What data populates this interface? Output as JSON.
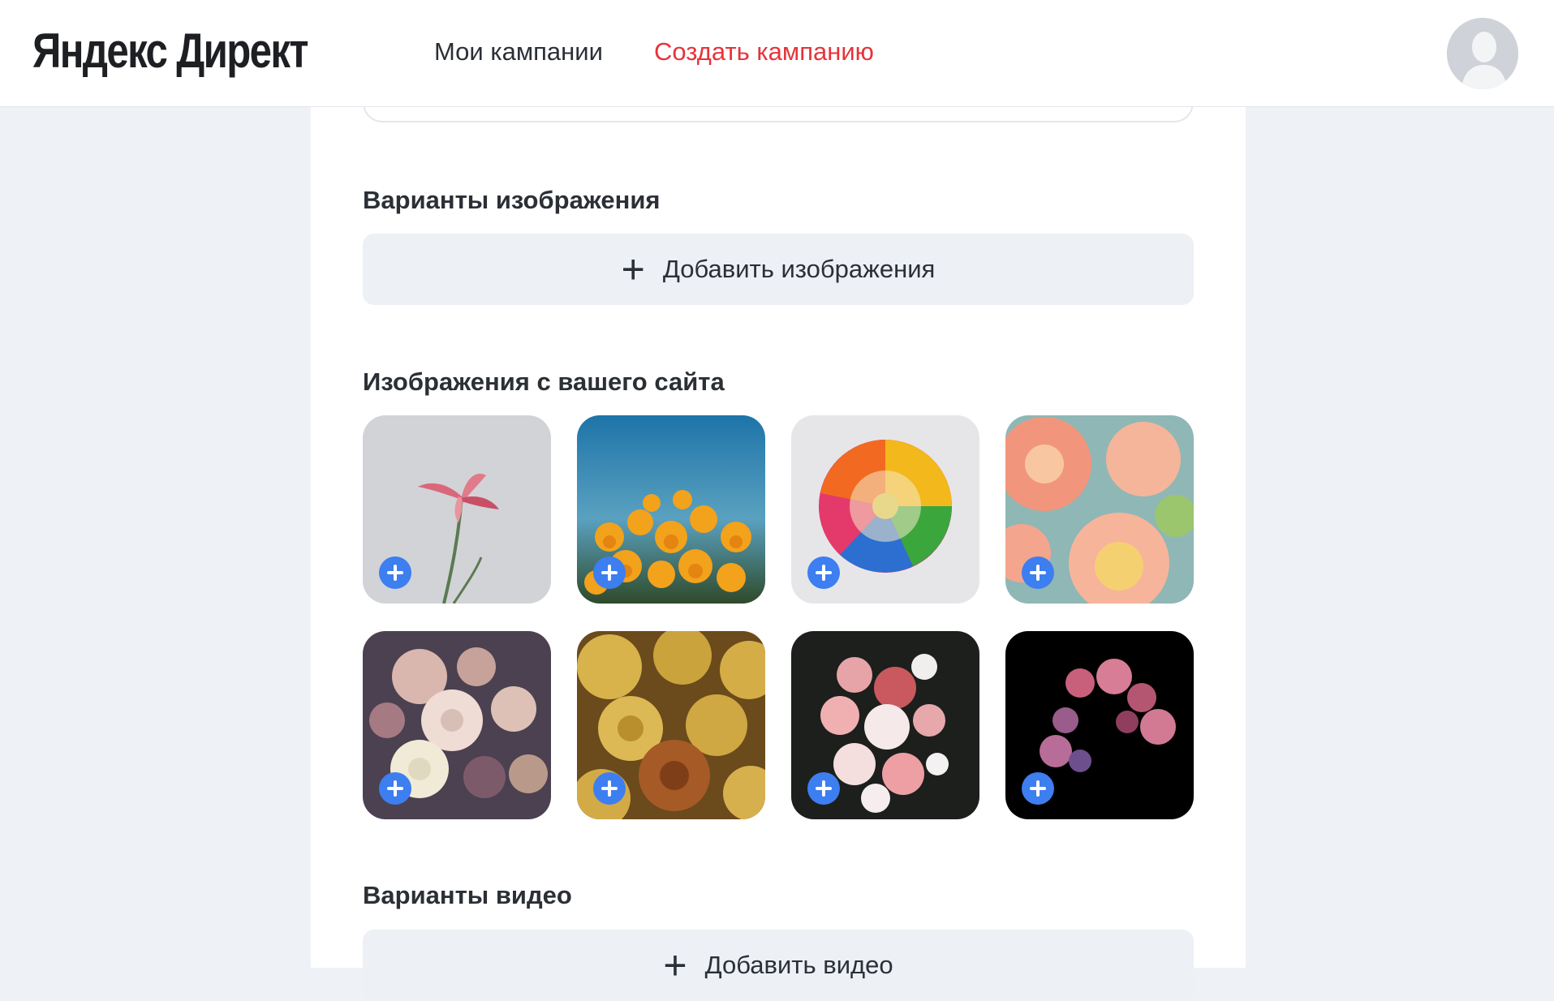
{
  "header": {
    "logo": "Яндекс Директ",
    "nav": {
      "my_campaigns": "Мои кампании",
      "create_campaign": "Создать кампанию"
    },
    "accent_color": "#e7333a"
  },
  "sections": {
    "image_variants": {
      "title": "Варианты изображения",
      "add_label": "Добавить изображения"
    },
    "site_images": {
      "title": "Изображения с вашего сайта",
      "images": [
        {
          "icon": "pink-lily-on-grey"
        },
        {
          "icon": "orange-poppies-blue-sky"
        },
        {
          "icon": "rainbow-chrysanthemum"
        },
        {
          "icon": "peach-dahlias"
        },
        {
          "icon": "vintage-roses-bouquet"
        },
        {
          "icon": "golden-roses"
        },
        {
          "icon": "pink-white-roses-dark"
        },
        {
          "icon": "pink-carnations-black"
        }
      ],
      "add_button_color": "#3d7ef0"
    },
    "video_variants": {
      "title": "Варианты видео",
      "add_label": "Добавить видео"
    }
  }
}
